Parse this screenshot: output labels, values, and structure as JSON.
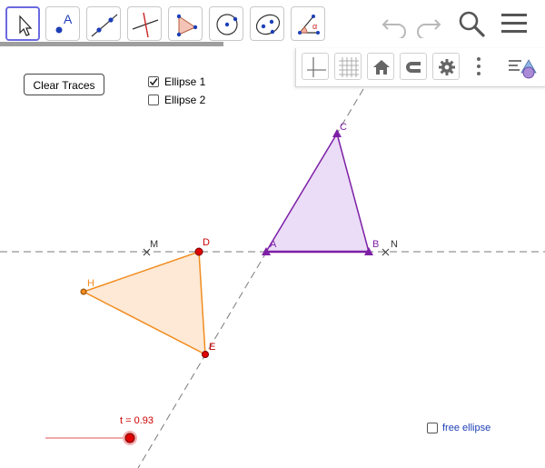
{
  "toolbar": {
    "tools": [
      {
        "name": "move-tool",
        "label": "Move"
      },
      {
        "name": "point-tool",
        "label": "A"
      },
      {
        "name": "line-tool",
        "label": "Line"
      },
      {
        "name": "perpendicular-line-tool",
        "label": "Perpendicular Line"
      },
      {
        "name": "polygon-tool",
        "label": "Polygon"
      },
      {
        "name": "circle-tool",
        "label": "Circle"
      },
      {
        "name": "ellipse-tool",
        "label": "Ellipse"
      },
      {
        "name": "angle-tool",
        "label": "Angle"
      }
    ],
    "point_tool_letter": "A",
    "angle_tool_symbol": "α",
    "accent_color": "#6b6be0"
  },
  "controls": {
    "clear_traces_label": "Clear Traces",
    "ellipse1_label": "Ellipse 1",
    "ellipse1_checked": true,
    "ellipse2_label": "Ellipse 2",
    "ellipse2_checked": false,
    "free_ellipse_label": "free ellipse",
    "free_ellipse_checked": false
  },
  "slider": {
    "label": "t = 0.93",
    "value": 0.93,
    "color": "#cc0000"
  },
  "graphics": {
    "points": {
      "A": "A",
      "B": "B",
      "C": "C",
      "D": "D",
      "E": "E",
      "H": "H",
      "M": "M",
      "N": "N"
    },
    "purple_color": "#7d1fa6",
    "purple_fill": "#ebdcf7",
    "orange_color": "#f28c1f",
    "orange_fill": "#fde9d6",
    "red_point_color": "#e00000",
    "dashed_line_color": "#7a7a7a"
  },
  "icons": {
    "undo": "undo-icon",
    "redo": "redo-icon",
    "search": "search-icon",
    "menu": "menu-icon",
    "axes": "axes-icon",
    "grid": "grid-icon",
    "home": "home-icon",
    "magnet": "magnet-icon",
    "settings": "gear-icon",
    "more": "more-vertical-icon",
    "view": "view-toggle-icon"
  }
}
